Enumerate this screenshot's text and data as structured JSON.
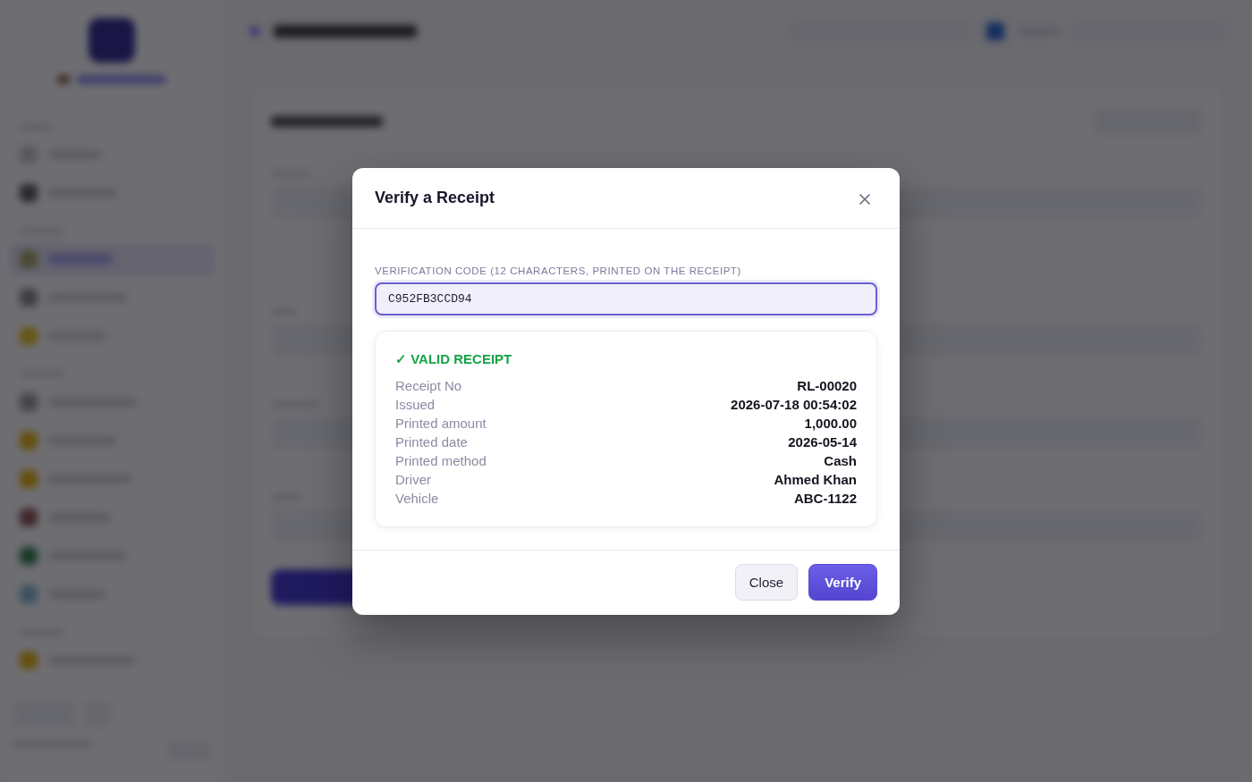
{
  "dialog": {
    "title": "Verify a Receipt",
    "field": {
      "label": "VERIFICATION CODE (12 CHARACTERS, PRINTED ON THE RECEIPT)",
      "value": "C952FB3CCD94",
      "focused": true
    },
    "result": {
      "valid": true,
      "heading": "✓ VALID RECEIPT",
      "rows": [
        {
          "label": "Receipt No",
          "value": "RL-00020"
        },
        {
          "label": "Issued",
          "value": "2026-07-18 00:54:02"
        },
        {
          "label": "Printed amount",
          "value": "1,000.00"
        },
        {
          "label": "Printed date",
          "value": "2026-05-14"
        },
        {
          "label": "Printed method",
          "value": "Cash"
        },
        {
          "label": "Driver",
          "value": "Ahmed Khan"
        },
        {
          "label": "Vehicle",
          "value": "ABC-1122"
        }
      ]
    },
    "buttons": [
      {
        "label": "Close",
        "kind": "secondary"
      },
      {
        "label": "Verify",
        "kind": "primary"
      }
    ]
  }
}
